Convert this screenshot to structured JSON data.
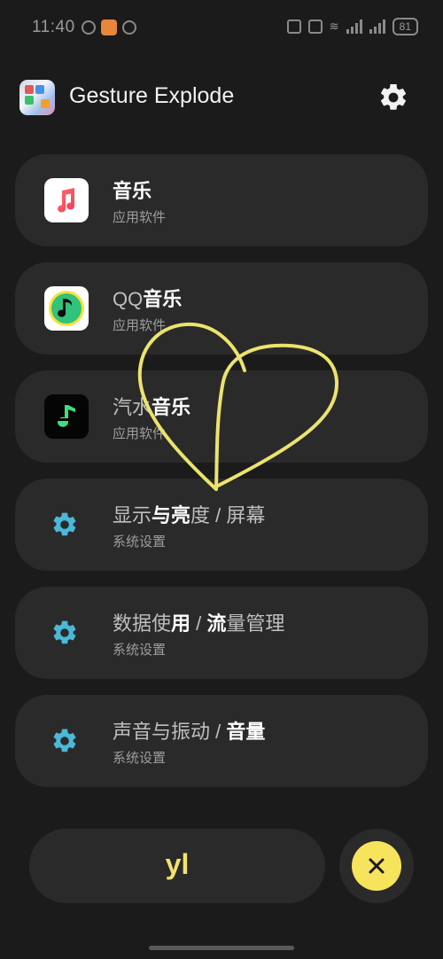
{
  "status": {
    "time": "11:40",
    "battery": "81"
  },
  "header": {
    "title": "Gesture Explode"
  },
  "results": [
    {
      "title_parts": [
        {
          "t": "音乐",
          "b": true
        }
      ],
      "subtitle": "应用软件"
    },
    {
      "title_parts": [
        {
          "t": "QQ",
          "b": false
        },
        {
          "t": "音乐",
          "b": true
        }
      ],
      "subtitle": "应用软件"
    },
    {
      "title_parts": [
        {
          "t": "汽水",
          "b": false
        },
        {
          "t": "音乐",
          "b": true
        }
      ],
      "subtitle": "应用软件"
    },
    {
      "title_parts": [
        {
          "t": "显示",
          "b": false
        },
        {
          "t": "与亮",
          "b": true
        },
        {
          "t": "度 / 屏幕",
          "b": false
        }
      ],
      "subtitle": "系统设置"
    },
    {
      "title_parts": [
        {
          "t": "数据使",
          "b": false
        },
        {
          "t": "用",
          "b": true
        },
        {
          "t": " / ",
          "b": false
        },
        {
          "t": "流",
          "b": true
        },
        {
          "t": "量管理",
          "b": false
        }
      ],
      "subtitle": "系统设置"
    },
    {
      "title_parts": [
        {
          "t": "声音与振动 / ",
          "b": false
        },
        {
          "t": "音量",
          "b": true
        }
      ],
      "subtitle": "系统设置"
    }
  ],
  "search": {
    "value": "yl"
  },
  "colors": {
    "accent": "#f7e35c",
    "gear": "#4bb8d8",
    "card": "#2a2a2a",
    "background": "#1b1b1b"
  },
  "icons": [
    "settings-icon",
    "apple-music-icon",
    "qq-music-icon",
    "qishui-music-icon",
    "gear-icon",
    "close-icon"
  ]
}
